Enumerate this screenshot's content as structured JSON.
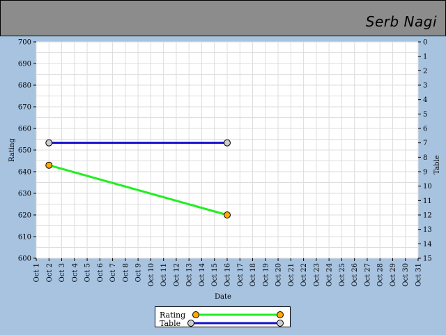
{
  "header": {
    "player_name": "Serb Nagi"
  },
  "colors": {
    "background": "#a7c3e0",
    "header": "#8c8c8c",
    "rating_line": "#22ee22",
    "table_line": "#1111cc",
    "rating_marker": "#ffaa00",
    "table_marker": "#cccccc"
  },
  "chart_data": {
    "type": "line",
    "title": "",
    "xlabel": "Date",
    "ylabel": "Rating",
    "y2label": "Table",
    "x_ticks": [
      "Oct 1",
      "Oct 2",
      "Oct 3",
      "Oct 4",
      "Oct 5",
      "Oct 6",
      "Oct 7",
      "Oct 8",
      "Oct 9",
      "Oct 10",
      "Oct 11",
      "Oct 12",
      "Oct 13",
      "Oct 14",
      "Oct 15",
      "Oct 16",
      "Oct 17",
      "Oct 18",
      "Oct 19",
      "Oct 20",
      "Oct 21",
      "Oct 22",
      "Oct 23",
      "Oct 24",
      "Oct 25",
      "Oct 26",
      "Oct 27",
      "Oct 28",
      "Oct 29",
      "Oct 30",
      "Oct 31"
    ],
    "ylim": [
      600,
      700
    ],
    "y_ticks": [
      600,
      610,
      620,
      630,
      640,
      650,
      660,
      670,
      680,
      690,
      700
    ],
    "y2lim": [
      15,
      0
    ],
    "y2_ticks": [
      0,
      1,
      2,
      3,
      4,
      5,
      6,
      7,
      8,
      9,
      10,
      11,
      12,
      13,
      14,
      15
    ],
    "grid": true,
    "legend_position": "bottom",
    "series": [
      {
        "name": "Rating",
        "axis": "left",
        "x": [
          "Oct 2",
          "Oct 16"
        ],
        "values": [
          643,
          620
        ]
      },
      {
        "name": "Table",
        "axis": "right",
        "x": [
          "Oct 2",
          "Oct 16"
        ],
        "values": [
          7,
          7
        ]
      }
    ]
  }
}
